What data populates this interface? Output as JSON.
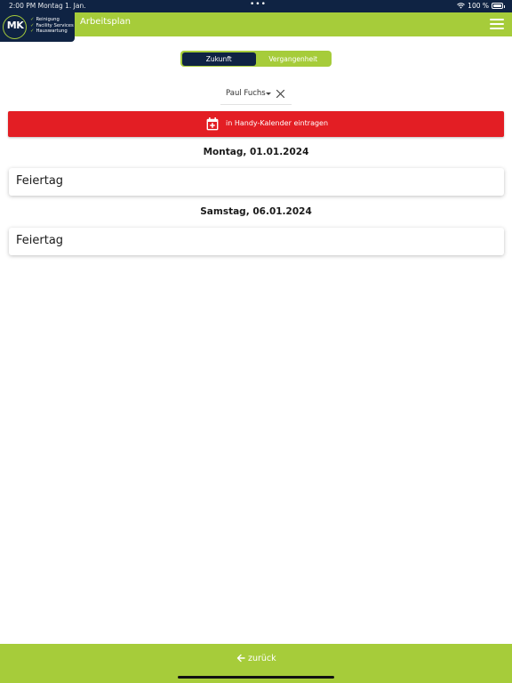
{
  "status_bar": {
    "time_date": "2:00 PM   Montag 1. Jan.",
    "dots": "•••",
    "battery": "100 %"
  },
  "logo": {
    "initials": "MK",
    "lines": [
      "Reinigung",
      "Facility Services",
      "Hauswartung"
    ]
  },
  "header": {
    "title": "Arbeitsplan",
    "menu_icon": "hamburger-menu-icon"
  },
  "tabs": [
    {
      "label": "Zukunft",
      "active": true
    },
    {
      "label": "Vergangenheit",
      "active": false
    }
  ],
  "user_filter": {
    "value": "Paul Fuchs"
  },
  "calendar_button": {
    "label": "in Handy-Kalender eintragen",
    "icon": "calendar-add-icon"
  },
  "days": [
    {
      "date": "Montag, 01.01.2024",
      "entries": [
        "Feiertag"
      ]
    },
    {
      "date": "Samstag, 06.01.2024",
      "entries": [
        "Feiertag"
      ]
    }
  ],
  "footer": {
    "back_label": "zurück",
    "back_icon": "arrow-left-icon"
  },
  "colors": {
    "brand_green": "#a6cc3a",
    "navy": "#0f2343",
    "action_red": "#e31e24"
  }
}
